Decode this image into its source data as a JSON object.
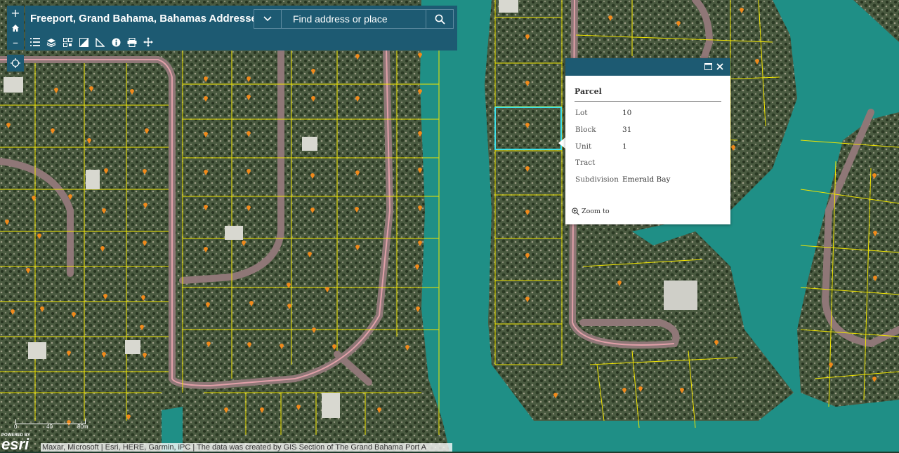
{
  "app": {
    "title": "Freeport, Grand Bahama, Bahamas Addresses"
  },
  "search": {
    "placeholder": "Find address or place"
  },
  "zoom": {
    "in": "+",
    "out": "–"
  },
  "toolbar": {
    "icons": [
      "list-icon",
      "layers-icon",
      "qr-icon",
      "basemap-icon",
      "measure-icon",
      "info-icon",
      "print-icon",
      "move-icon"
    ]
  },
  "popup": {
    "title": "Parcel",
    "fields": [
      {
        "label": "Lot",
        "value": "10"
      },
      {
        "label": "Block",
        "value": "31"
      },
      {
        "label": "Unit",
        "value": "1"
      },
      {
        "label": "Tract",
        "value": ""
      },
      {
        "label": "Subdivision",
        "value": "Emerald Bay"
      }
    ],
    "zoom_to": "Zoom to"
  },
  "scale": {
    "left": "0",
    "mid": "40",
    "right": "80m"
  },
  "brand": {
    "powered_by": "POWERED BY",
    "name": "esri"
  },
  "attribution": "Maxar, Microsoft | Esri, HERE, Garmin, iPC | The data was created by GIS Section of The Grand Bahama Port A",
  "colors": {
    "header": "#1d5a72",
    "water": "#1f8f86",
    "parcel_line": "#f2e600",
    "marker": "#f08a1c",
    "road": "#c98a8a",
    "highlight": "#3fe0e8"
  }
}
